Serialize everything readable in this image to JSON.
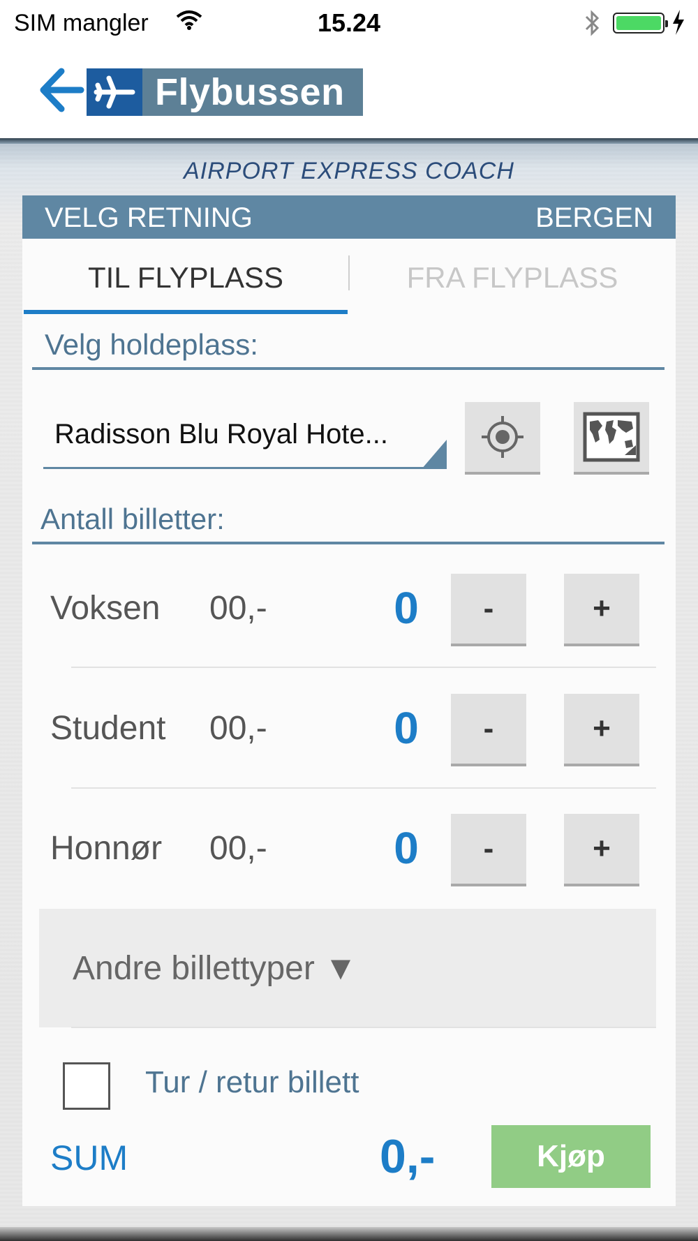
{
  "status_bar": {
    "carrier": "SIM mangler",
    "time": "15.24",
    "icons": [
      "wifi-icon",
      "bluetooth-icon",
      "battery-icon",
      "charging-bolt-icon"
    ]
  },
  "header": {
    "back_icon": "arrow-left-icon",
    "logo_icon": "airplane-icon",
    "logo_text": "Flybussen"
  },
  "subtitle": "AIRPORT EXPRESS COACH",
  "direction_bar": {
    "label": "VELG RETNING",
    "city": "BERGEN"
  },
  "tabs": [
    {
      "label": "TIL FLYPLASS",
      "active": true
    },
    {
      "label": "FRA FLYPLASS",
      "active": false
    }
  ],
  "stop": {
    "section_label": "Velg holdeplass:",
    "selected": "Radisson Blu Royal Hote...",
    "locate_icon": "locate-crosshair-icon",
    "map_icon": "world-map-icon"
  },
  "tickets": {
    "section_label": "Antall billetter:",
    "rows": [
      {
        "label": "Voksen",
        "price": "00,-",
        "count": "0",
        "minus": "-",
        "plus": "+"
      },
      {
        "label": "Student",
        "price": "00,-",
        "count": "0",
        "minus": "-",
        "plus": "+"
      },
      {
        "label": "Honnør",
        "price": "00,-",
        "count": "0",
        "minus": "-",
        "plus": "+"
      }
    ],
    "other_types": "Andre billettyper ▼"
  },
  "round_trip": {
    "label": "Tur / retur billett",
    "checked": false
  },
  "footer": {
    "sum_label": "SUM",
    "sum_value": "0,-",
    "buy_label": "Kjøp"
  },
  "colors": {
    "accent_blue": "#1d7dc7",
    "bar_blue": "#5f87a3",
    "buy_green": "#91cc85"
  }
}
